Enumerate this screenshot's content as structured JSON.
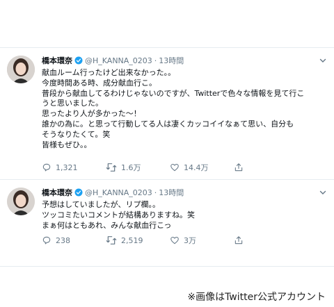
{
  "tweets": [
    {
      "name": "橋本環奈",
      "handle": "@H_KANNA_0203",
      "dot": "·",
      "time": "13時間",
      "lines": [
        "献血ルーム行ったけど出来なかった。。",
        "今度時間ある時、成分献血行こ。",
        "普段から献血してるわけじゃないのですが、Twitterで色々な情報を見て行こ",
        "うと思いました。",
        "思ったより人が多かった〜！",
        "誰かの為に。と思って行動してる人は凄くカッコイイなぁて思い、自分も",
        "そうなりたくて。笑",
        "皆様もぜひ。。"
      ],
      "replies": "1,321",
      "retweets": "1.6万",
      "likes": "14.4万"
    },
    {
      "name": "橋本環奈",
      "handle": "@H_KANNA_0203",
      "dot": "·",
      "time": "13時間",
      "lines": [
        "予想はしていましたが、リプ欄。。",
        "ツッコミたいコメントが結構ありますね。笑",
        "まぁ何はともあれ、みんな献血行こっ"
      ],
      "replies": "238",
      "retweets": "2,519",
      "likes": "3万"
    }
  ],
  "credit": "※画像はTwitter公式アカウント",
  "colors": {
    "verified": "#1da1f2",
    "muted": "#657786",
    "border": "#e6ecf0"
  }
}
